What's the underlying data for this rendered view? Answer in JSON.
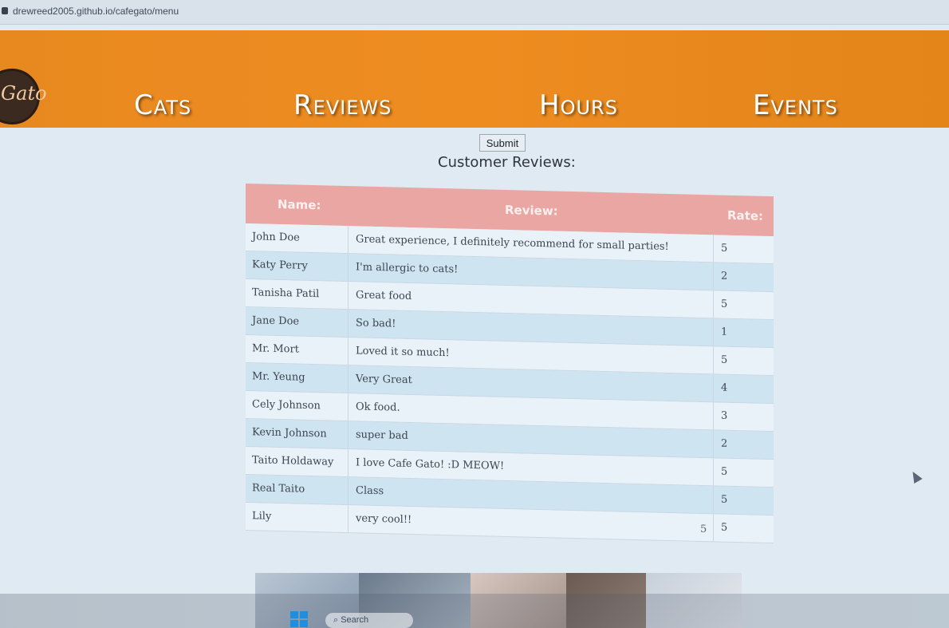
{
  "browser": {
    "url": "drewreed2005.github.io/cafegato/menu"
  },
  "header": {
    "logo_text": "Gato",
    "nav": [
      "Cats",
      "Reviews",
      "Hours",
      "Events"
    ]
  },
  "form": {
    "submit_label": "Submit"
  },
  "reviews": {
    "title": "Customer Reviews:",
    "columns": {
      "name": "Name:",
      "review": "Review:",
      "rate": "Rate:"
    },
    "rows": [
      {
        "name": "John Doe",
        "review": "Great experience, I definitely recommend for small parties!",
        "rate": "5"
      },
      {
        "name": "Katy Perry",
        "review": "I'm allergic to cats!",
        "rate": "2"
      },
      {
        "name": "Tanisha Patil",
        "review": "Great food",
        "rate": "5"
      },
      {
        "name": "Jane Doe",
        "review": "So bad!",
        "rate": "1"
      },
      {
        "name": "Mr. Mort",
        "review": "Loved it so much!",
        "rate": "5"
      },
      {
        "name": "Mr. Yeung",
        "review": "Very Great",
        "rate": "4"
      },
      {
        "name": "Cely Johnson",
        "review": "Ok food.",
        "rate": "3"
      },
      {
        "name": "Kevin Johnson",
        "review": "super bad",
        "rate": "2"
      },
      {
        "name": "Taito Holdaway",
        "review": "I love Cafe Gato! :D MEOW!",
        "rate": "5"
      },
      {
        "name": "Real Taito",
        "review": "Class",
        "rate": "5"
      },
      {
        "name": "Lily",
        "review": "very cool!!",
        "rate": "5"
      }
    ],
    "extra_rate": "5"
  },
  "taskbar": {
    "search_label": "Search"
  },
  "colors": {
    "nav_bg": "#ee8c20",
    "table_header_bg": "#e9a6a2",
    "row_even": "#cfe4f1",
    "row_odd": "#e9f2f8"
  }
}
